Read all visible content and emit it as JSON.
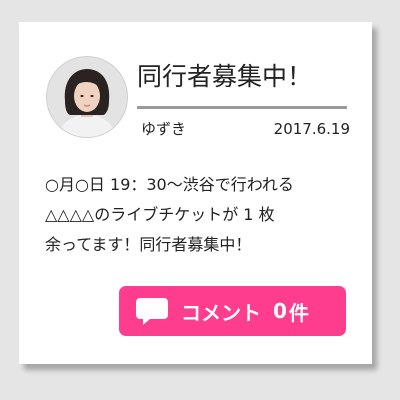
{
  "post": {
    "title": "同行者募集中！",
    "author": "ゆずき",
    "date": "2017.6.19",
    "body_lines": [
      "○月○日 19：30～渋谷で行われる",
      "△△△△のライブチケットが 1 枚",
      "余ってます！同行者募集中！"
    ]
  },
  "comments": {
    "label": "コメント",
    "count": "0",
    "unit": "件"
  },
  "colors": {
    "accent": "#ff3d8e",
    "page_background": "#e5e5e5",
    "card_background": "#ffffff",
    "divider": "#9a9a9a"
  },
  "icons": {
    "avatar": "user-avatar-photo",
    "comment": "speech-bubble-icon"
  }
}
